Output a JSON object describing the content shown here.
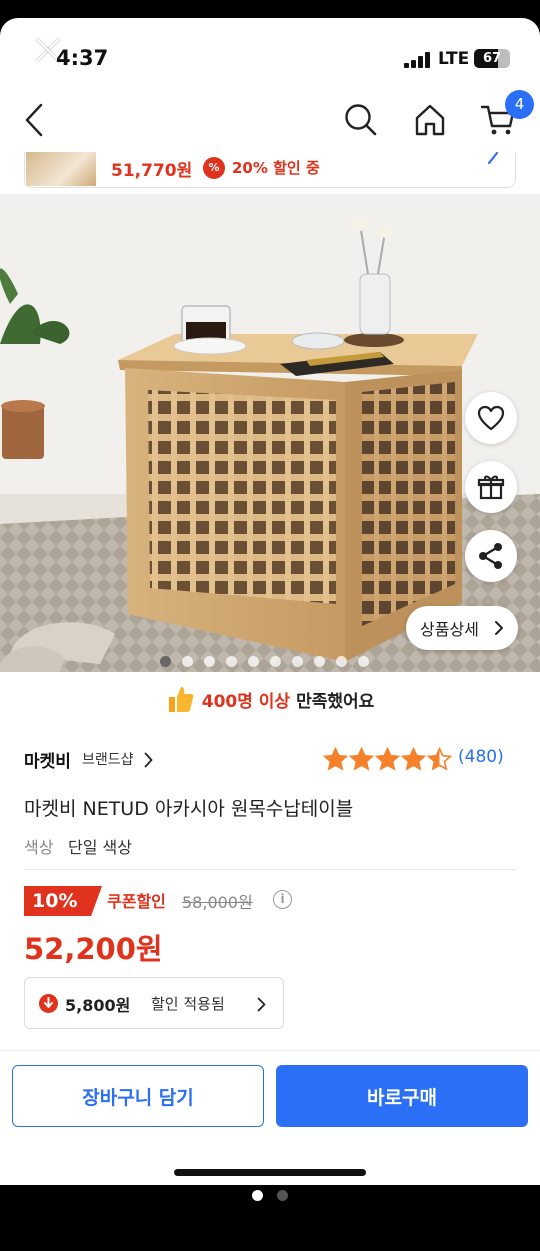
{
  "status_bar": {
    "time": "4:37",
    "network": "LTE",
    "battery": "67",
    "battery_level_percent": 67
  },
  "nav": {
    "back_icon": "chevron-left-icon",
    "search_icon": "search-icon",
    "home_icon": "home-icon",
    "cart_icon": "cart-icon",
    "cart_count": "4"
  },
  "sticky_bar": {
    "price": "51,770원",
    "coupon_icon_text": "%",
    "discount": "20% 할인 중"
  },
  "gallery": {
    "total_images": 10,
    "active_index": 0,
    "detail_button": "상품상세"
  },
  "float_actions": {
    "wishlist_icon": "heart-icon",
    "gift_icon": "gift-icon",
    "share_icon": "share-icon"
  },
  "satisfaction": {
    "count": "400명 이상",
    "text": "만족했어요"
  },
  "product": {
    "brand": "마켓비",
    "brand_shop": "브랜드샵",
    "rating": 4.5,
    "review_count": "(480)",
    "title": "마켓비 NETUD 아카시아 원목수납테이블",
    "option_label": "색상",
    "option_value": "단일 색상"
  },
  "pricing": {
    "discount_badge": "10%",
    "coupon_label": "쿠폰할인",
    "original_price": "58,000원",
    "final_price": "52,200원",
    "saving_amount": "5,800원",
    "saving_text": "할인 적용됨"
  },
  "actions": {
    "add_to_cart": "장바구니 담기",
    "buy_now": "바로구매"
  },
  "colors": {
    "accent_blue": "#2b6ff6",
    "sale_red": "#e0321c",
    "star_orange": "#f5822a"
  }
}
